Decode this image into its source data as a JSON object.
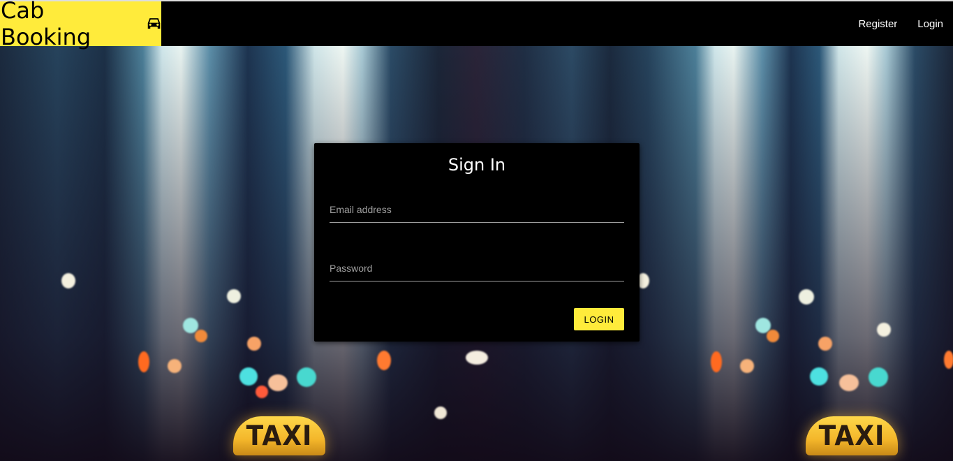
{
  "header": {
    "brand": "Cab Booking",
    "brand_icon": "car-icon",
    "nav": [
      {
        "label": "Register"
      },
      {
        "label": "Login"
      }
    ]
  },
  "signin": {
    "title": "Sign In",
    "email_placeholder": "Email address",
    "password_placeholder": "Password",
    "login_button": "LOGIN"
  },
  "background": {
    "sign_text_left": "TAXI",
    "sign_text_right": "TAXI"
  },
  "colors": {
    "accent": "#ffeb3b",
    "card": "#000000",
    "navbar": "#000000"
  }
}
